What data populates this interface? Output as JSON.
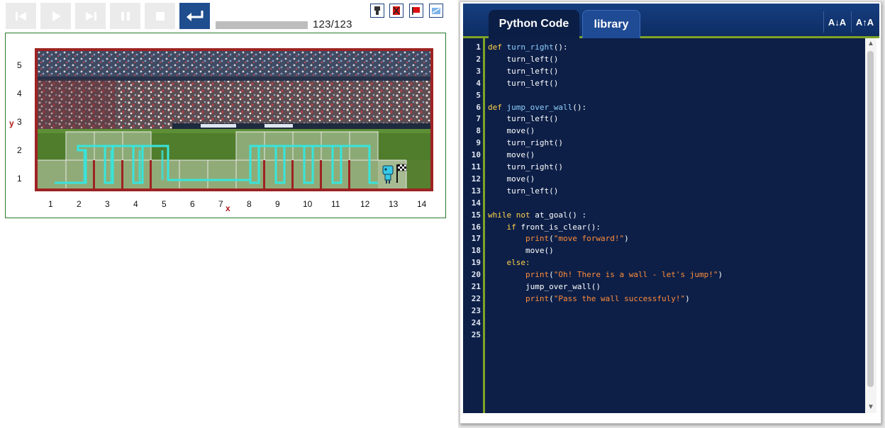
{
  "controls": {
    "buttons": [
      {
        "name": "first-step-button",
        "icon": "skip-back-icon"
      },
      {
        "name": "play-button",
        "icon": "play-icon"
      },
      {
        "name": "next-step-button",
        "icon": "skip-forward-icon"
      },
      {
        "name": "pause-button",
        "icon": "pause-icon"
      },
      {
        "name": "stop-button",
        "icon": "stop-icon"
      },
      {
        "name": "run-button",
        "icon": "return-arrow-icon"
      }
    ],
    "progress_fraction": 1.0,
    "step_counter": "123/123",
    "tools": [
      "robot-tool-icon",
      "clear-world-icon",
      "flag-icon",
      "world-edit-icon"
    ]
  },
  "world": {
    "y_axis_label": "y",
    "x_axis_label": "x",
    "y_ticks": [
      "5",
      "4",
      "3",
      "2",
      "1"
    ],
    "x_ticks": [
      "1",
      "2",
      "3",
      "4",
      "5",
      "6",
      "7",
      "8",
      "9",
      "10",
      "11",
      "12",
      "13",
      "14"
    ],
    "colors": {
      "border": "#9d2323",
      "trace": "#37e5dd",
      "wall": "#9d2323"
    }
  },
  "ide": {
    "tabs": [
      {
        "label": "Python Code",
        "active": true
      },
      {
        "label": "library",
        "active": false
      }
    ],
    "font_decrease_label": "A↓A",
    "font_increase_label": "A↑A",
    "line_numbers": [
      "1",
      "2",
      "3",
      "4",
      "5",
      "6",
      "7",
      "8",
      "9",
      "10",
      "11",
      "12",
      "13",
      "14",
      "15",
      "16",
      "17",
      "18",
      "19",
      "20",
      "21",
      "22",
      "23",
      "24",
      "25"
    ],
    "code_lines": [
      "def turn_right():",
      "    turn_left()",
      "    turn_left()",
      "    turn_left()",
      "",
      "def jump_over_wall():",
      "    turn_left()",
      "    move()",
      "    turn_right()",
      "    move()",
      "    turn_right()",
      "    move()",
      "    turn_left()",
      "",
      "while not at_goal() :",
      "    if front_is_clear():",
      "        print(\"move forward!\")",
      "        move()",
      "    else:",
      "        print(\"Oh! There is a wall - let's jump!\")",
      "        jump_over_wall()",
      "        print(\"Pass the wall successfuly!\")",
      "",
      "",
      ""
    ]
  }
}
